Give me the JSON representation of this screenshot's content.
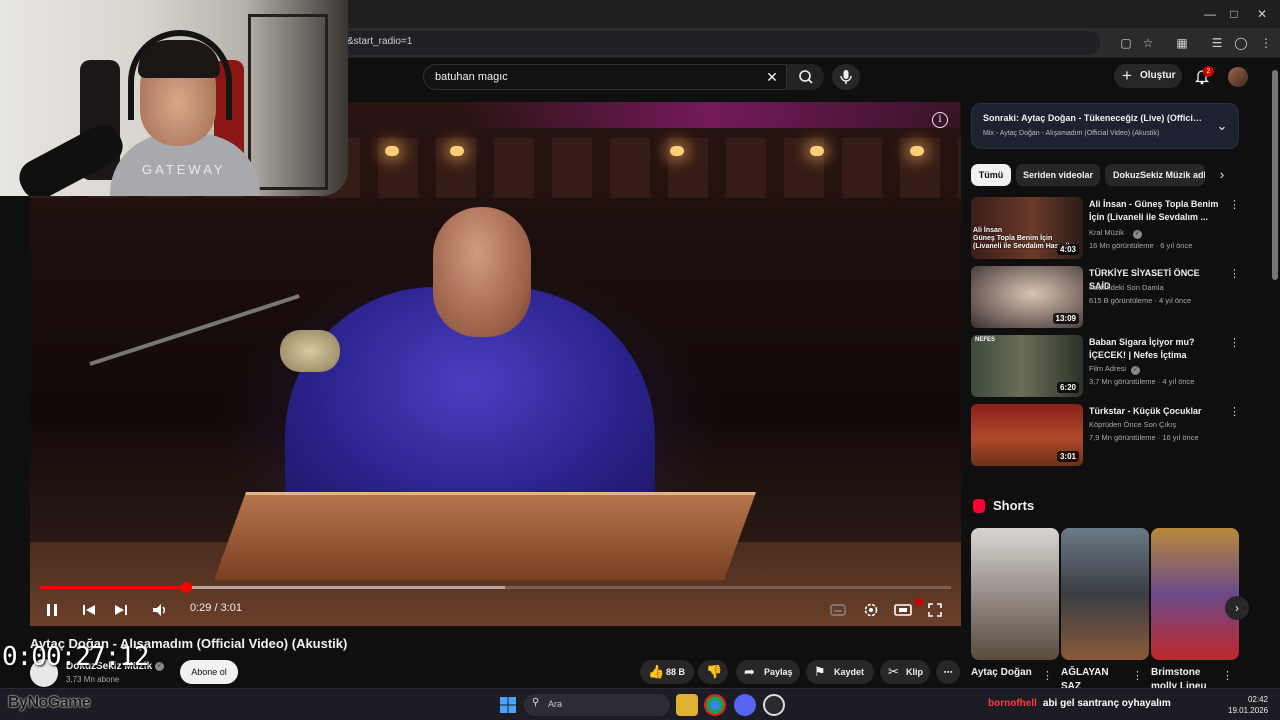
{
  "browser": {
    "url_fragment": "&start_radio=1"
  },
  "header": {
    "search_query": "batuhan magıc",
    "create_label": "Oluştur",
    "notification_count": "2"
  },
  "player": {
    "current_time": "0:29",
    "duration": "3:01",
    "time_display": "0:29 / 3:01",
    "progress_fraction": 0.16,
    "buffered_fraction": 0.51,
    "info_glyph": "i"
  },
  "video": {
    "title": "Aytaç Doğan - Alışamadım (Official Video) (Akustik)",
    "channel": "DokuzSekiz Müzik",
    "subscribers": "3,73 Mn abone",
    "subscribe_label": "Abone ol",
    "like_count": "88 B",
    "share_label": "Paylaş",
    "save_label": "Kaydet",
    "clip_label": "Klip"
  },
  "overlay": {
    "stream_timer": "0:00:27:12",
    "webcam_shirt_text": "GATEWAY",
    "sponsor_logo": "ByNoGame"
  },
  "sidebar": {
    "up_next_title": "Sonraki: Aytaç Doğan - Tükeneceğiz (Live) (Official ...",
    "up_next_subtitle": "Mix - Aytaç Doğan - Alışamadım (Official Video) (Akustik)",
    "chips": [
      "Tümü",
      "Seriden videolar",
      "DokuzSekiz Müzik adlı kanal"
    ],
    "recommendations": [
      {
        "title": "Ali İnsan - Güneş Topla Benim İçin (Livaneli ile Sevdalım ...",
        "channel": "Kral Müzik",
        "verified": true,
        "meta": "16 Mn görüntüleme · 6 yıl önce",
        "duration": "4:03",
        "thumb_caption_1": "Ali İnsan",
        "thumb_caption_2": "Güneş Topla Benim İçin",
        "thumb_caption_3": "(Livaneli ile Sevdalım Hasret)"
      },
      {
        "title": "TÜRKİYE SİYASETİ ÖNCE SAİD",
        "channel": "Kadehdeki Son Damla",
        "verified": false,
        "meta": "615 B görüntüleme · 4 yıl önce",
        "duration": "13:09"
      },
      {
        "title": "Baban Sigara İçiyor mu? İÇECEK! | Nefes İçtima Sahnesi",
        "channel": "Film Adresi",
        "verified": true,
        "meta": "3,7 Mn görüntüleme · 4 yıl önce",
        "duration": "6:20",
        "thumb_caption_1": "NEFES"
      },
      {
        "title": "Türkstar - Küçük Çocuklar",
        "channel": "Köprüden Önce Son Çıkış",
        "verified": false,
        "meta": "7,9 Mn görüntüleme · 16 yıl önce",
        "duration": "3:01"
      }
    ],
    "shorts_heading": "Shorts",
    "shorts": [
      {
        "title": "Aytaç Doğan"
      },
      {
        "title": "AĞLAYAN SAZ"
      },
      {
        "title": "Brimstone molly Lineu"
      }
    ]
  },
  "taskbar": {
    "search_placeholder": "Ara",
    "chat_user": "bornofhell",
    "chat_message": "abi gel santranç oyhayalım",
    "clock_time": "02:42",
    "clock_date": "19.01.2026"
  },
  "colors": {
    "accent_red": "#ff0000",
    "background": "#0f0f0f",
    "chip_bg": "#272727",
    "up_next_bg": "#1e2230"
  }
}
